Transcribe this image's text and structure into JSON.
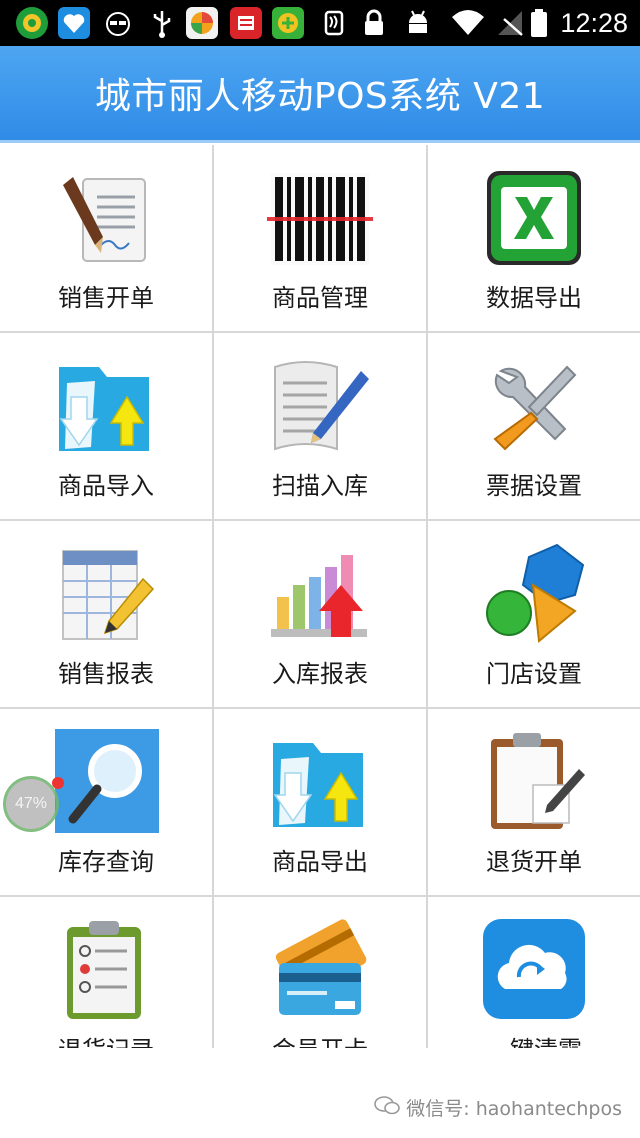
{
  "status_bar": {
    "time": "12:28",
    "notification_icons": [
      "app-badge-icon",
      "health-icon",
      "cat-face-icon",
      "usb-icon",
      "photo-app-icon",
      "news-app-icon",
      "security-app-icon"
    ],
    "system_icons": [
      "nfc-icon",
      "lock-icon",
      "android-icon",
      "wifi-icon",
      "no-signal-icon",
      "battery-icon"
    ]
  },
  "header": {
    "title": "城市丽人移动POS系统 V21"
  },
  "menu": {
    "items": [
      {
        "label": "销售开单",
        "icon": "document-sign-icon"
      },
      {
        "label": "商品管理",
        "icon": "barcode-icon"
      },
      {
        "label": "数据导出",
        "icon": "excel-icon"
      },
      {
        "label": "商品导入",
        "icon": "folder-import-icon"
      },
      {
        "label": "扫描入库",
        "icon": "news-pen-icon"
      },
      {
        "label": "票据设置",
        "icon": "tools-icon"
      },
      {
        "label": "销售报表",
        "icon": "spreadsheet-pencil-icon"
      },
      {
        "label": "入库报表",
        "icon": "bar-chart-icon"
      },
      {
        "label": "门店设置",
        "icon": "shapes-icon"
      },
      {
        "label": "库存查询",
        "icon": "magnifier-icon"
      },
      {
        "label": "商品导出",
        "icon": "folder-export-icon"
      },
      {
        "label": "退货开单",
        "icon": "clipboard-pen-icon"
      },
      {
        "label": "退货记录",
        "icon": "checklist-icon"
      },
      {
        "label": "会员开卡",
        "icon": "credit-card-icon"
      },
      {
        "label": "一键清零",
        "icon": "cloud-refresh-icon"
      }
    ]
  },
  "floating_widget": {
    "value": "47%"
  },
  "watermark": {
    "text": "微信号: haohantechpos"
  },
  "colors": {
    "header": "#3a97ec",
    "status_bar": "#000000",
    "grid_line": "#d7d7d7"
  }
}
